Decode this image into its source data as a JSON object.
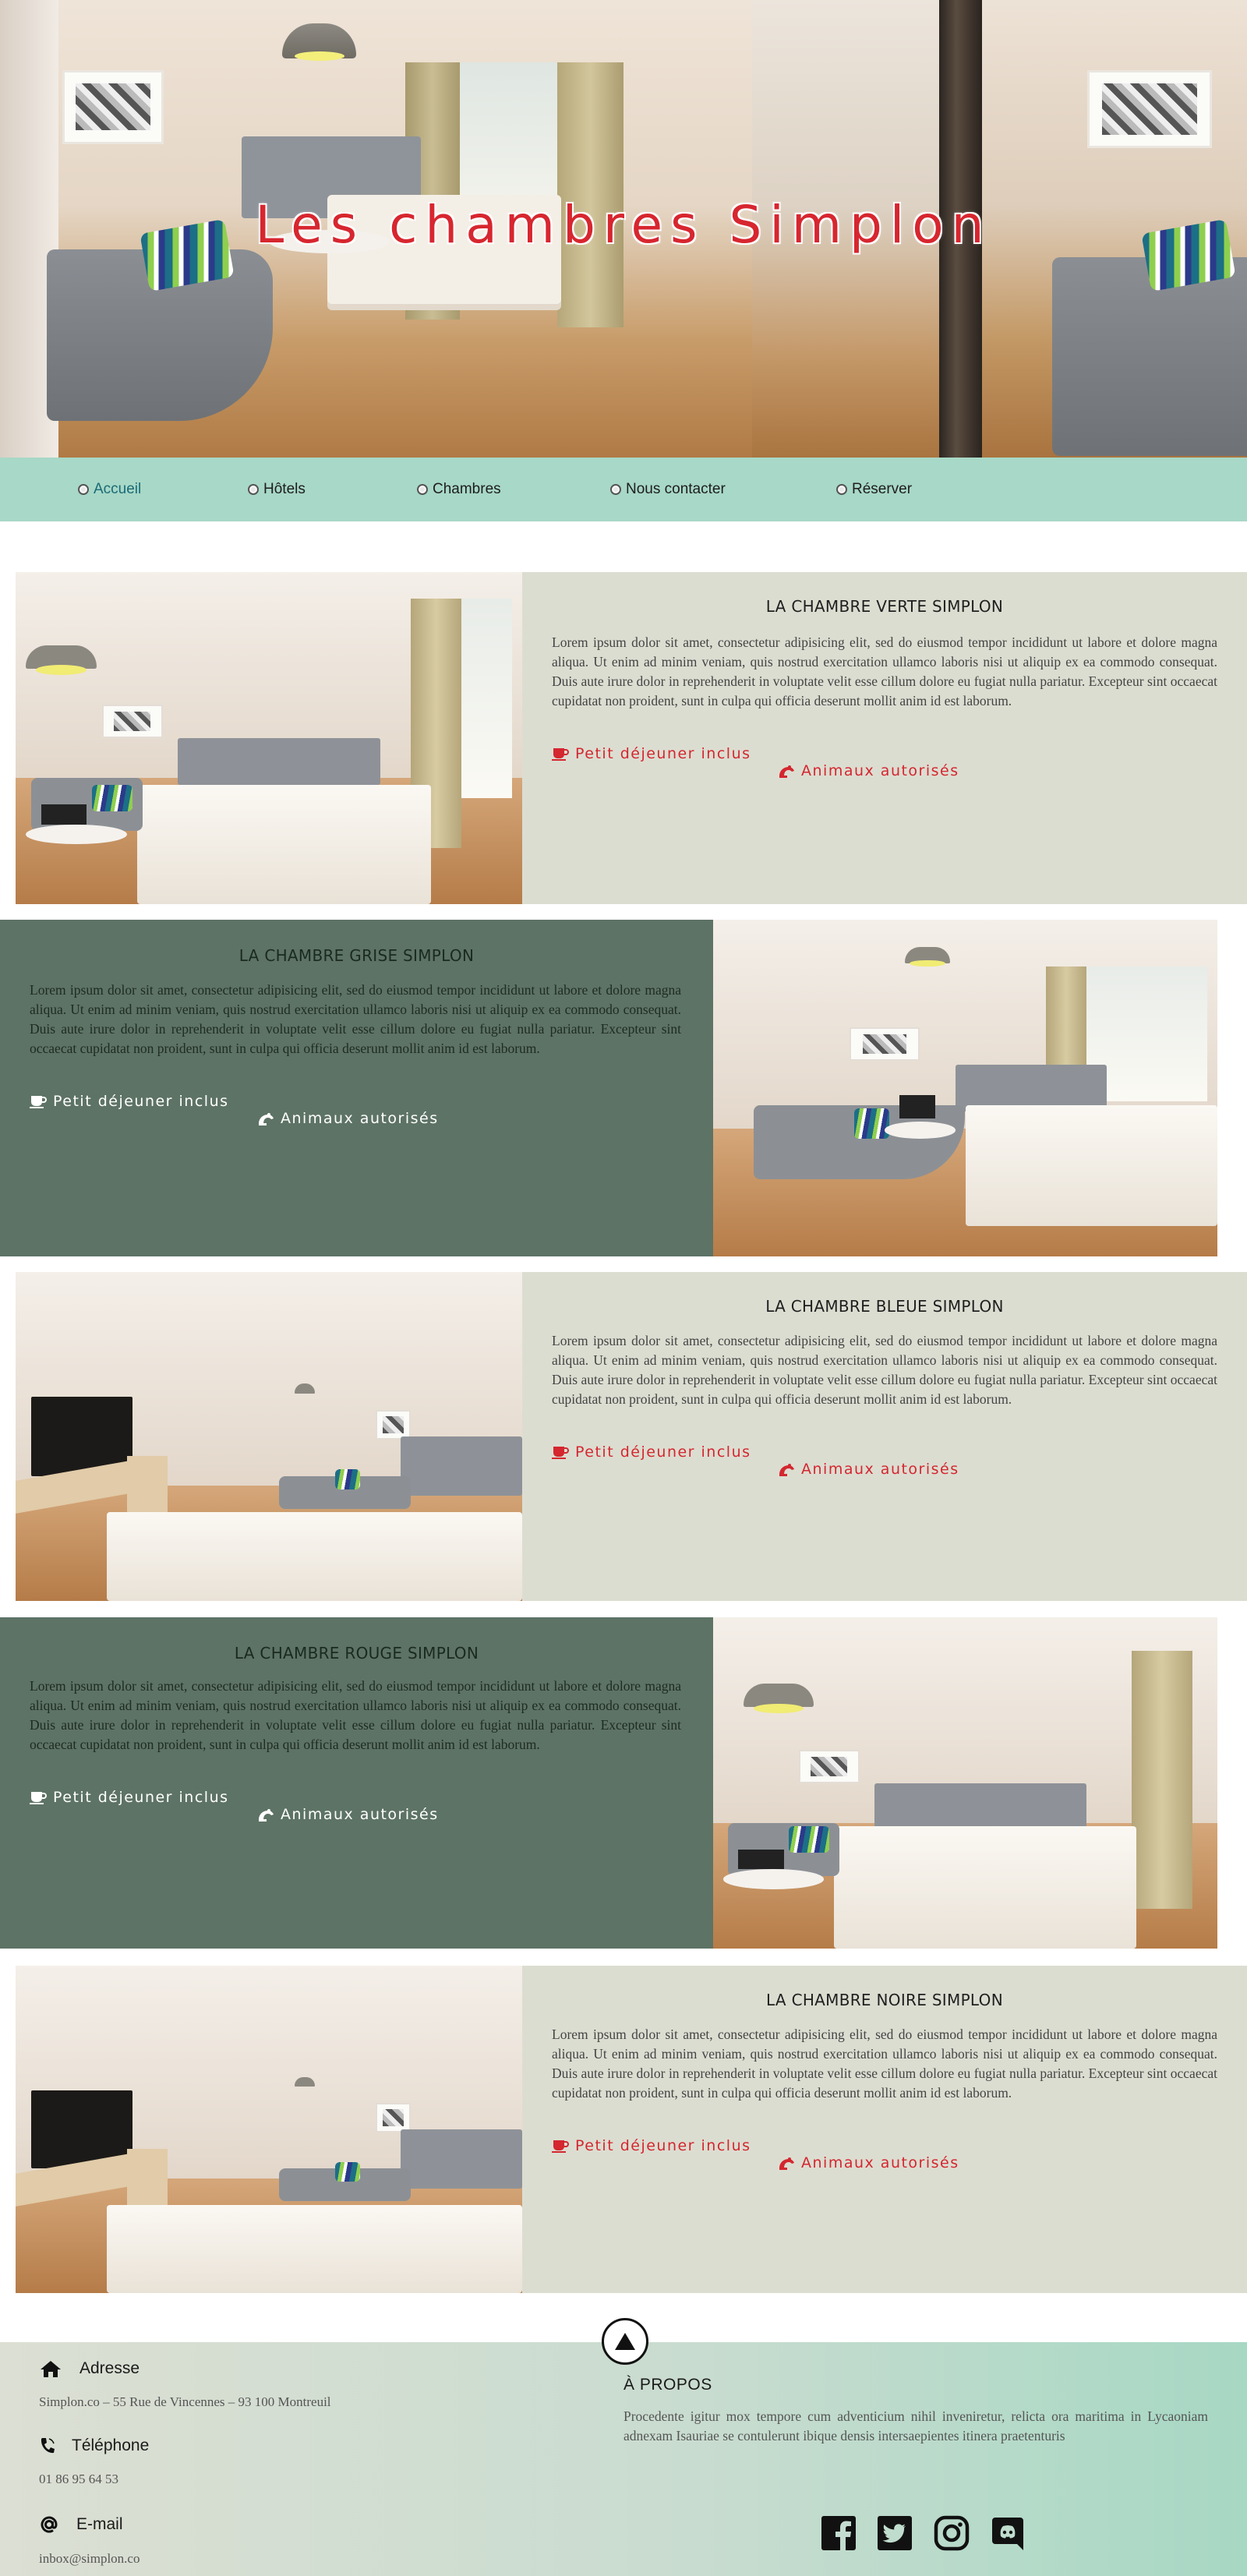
{
  "hero": {
    "title": "Les chambres Simplon"
  },
  "nav": {
    "items": [
      {
        "label": "Accueil",
        "active": true
      },
      {
        "label": "Hôtels"
      },
      {
        "label": "Chambres"
      },
      {
        "label": "Nous contacter"
      },
      {
        "label": "Réserver"
      }
    ]
  },
  "rooms": [
    {
      "title": "LA CHAMBRE VERTE SIMPLON",
      "description": "Lorem ipsum dolor sit amet, consectetur adipisicing elit, sed do eiusmod tempor incididunt ut labore et dolore magna aliqua. Ut enim ad minim veniam, quis nostrud exercitation ullamco laboris nisi ut aliquip ex ea commodo consequat. Duis aute irure dolor in reprehenderit in voluptate velit esse cillum dolore eu fugiat nulla pariatur. Excepteur sint occaecat cupidatat non proident, sunt in culpa qui officia deserunt mollit anim id est laborum.",
      "feature_breakfast": "Petit déjeuner inclus",
      "feature_pets": "Animaux autorisés"
    },
    {
      "title": "LA CHAMBRE GRISE SIMPLON",
      "description": "Lorem ipsum dolor sit amet, consectetur adipisicing elit, sed do eiusmod tempor incididunt ut labore et dolore magna aliqua. Ut enim ad minim veniam, quis nostrud exercitation ullamco laboris nisi ut aliquip ex ea commodo consequat. Duis aute irure dolor in reprehenderit in voluptate velit esse cillum dolore eu fugiat nulla pariatur. Excepteur sint occaecat cupidatat non proident, sunt in culpa qui officia deserunt mollit anim id est laborum.",
      "feature_breakfast": "Petit déjeuner inclus",
      "feature_pets": "Animaux autorisés"
    },
    {
      "title": "LA CHAMBRE BLEUE SIMPLON",
      "description": "Lorem ipsum dolor sit amet, consectetur adipisicing elit, sed do eiusmod tempor incididunt ut labore et dolore magna aliqua. Ut enim ad minim veniam, quis nostrud exercitation ullamco laboris nisi ut aliquip ex ea commodo consequat. Duis aute irure dolor in reprehenderit in voluptate velit esse cillum dolore eu fugiat nulla pariatur. Excepteur sint occaecat cupidatat non proident, sunt in culpa qui officia deserunt mollit anim id est laborum.",
      "feature_breakfast": "Petit déjeuner inclus",
      "feature_pets": "Animaux autorisés"
    },
    {
      "title": "LA CHAMBRE ROUGE SIMPLON",
      "description": "Lorem ipsum dolor sit amet, consectetur adipisicing elit, sed do eiusmod tempor incididunt ut labore et dolore magna aliqua. Ut enim ad minim veniam, quis nostrud exercitation ullamco laboris nisi ut aliquip ex ea commodo consequat. Duis aute irure dolor in reprehenderit in voluptate velit esse cillum dolore eu fugiat nulla pariatur. Excepteur sint occaecat cupidatat non proident, sunt in culpa qui officia deserunt mollit anim id est laborum.",
      "feature_breakfast": "Petit déjeuner inclus",
      "feature_pets": "Animaux autorisés"
    },
    {
      "title": "LA CHAMBRE NOIRE SIMPLON",
      "description": "Lorem ipsum dolor sit amet, consectetur adipisicing elit, sed do eiusmod tempor incididunt ut labore et dolore magna aliqua. Ut enim ad minim veniam, quis nostrud exercitation ullamco laboris nisi ut aliquip ex ea commodo consequat. Duis aute irure dolor in reprehenderit in voluptate velit esse cillum dolore eu fugiat nulla pariatur. Excepteur sint occaecat cupidatat non proident, sunt in culpa qui officia deserunt mollit anim id est laborum.",
      "feature_breakfast": "Petit déjeuner inclus",
      "feature_pets": "Animaux autorisés"
    }
  ],
  "footer": {
    "address_label": "Adresse",
    "address_value": "Simplon.co – 55 Rue de Vincennes – 93 100 Montreuil",
    "phone_label": "Téléphone",
    "phone_value": "01 86 95 64 53",
    "email_label": "E-mail",
    "email_value": "inbox@simplon.co",
    "about_title": "À PROPOS",
    "about_text": "Procedente igitur mox tempore cum adventicium nihil inveniretur, relicta ora maritima in Lycaoniam adnexam Isauriae se contulerunt ibique densis intersaepientes itinera praetenturis",
    "social": [
      "facebook-icon",
      "twitter-icon",
      "instagram-icon",
      "discord-icon"
    ]
  },
  "colors": {
    "nav_bg": "#a8d8c7",
    "light_panel": "#dcddd1",
    "dark_panel": "#5d7365",
    "accent_red": "#d4272f",
    "active_link": "#1a6b78"
  }
}
